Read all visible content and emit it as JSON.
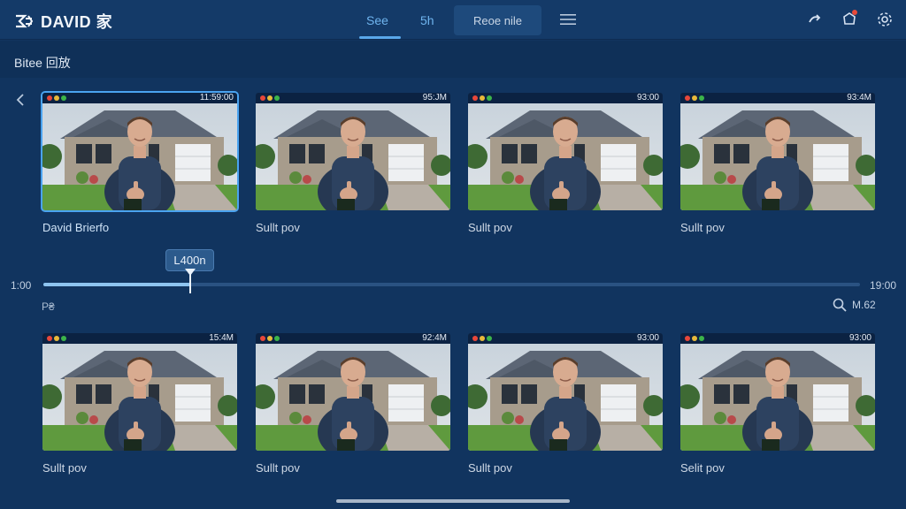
{
  "header": {
    "app_title": "DAVID 家",
    "tabs": [
      {
        "label": "See",
        "active": true
      },
      {
        "label": "5h",
        "active": false
      }
    ],
    "boxed_tab": "Reoe nile",
    "icons": [
      "logo-icon",
      "menu-icon",
      "share-icon",
      "notification-icon",
      "settings-icon"
    ]
  },
  "subheader": {
    "title": "Bitee 回放"
  },
  "row1": [
    {
      "time": "11:59:00",
      "caption": "David Brierfo",
      "selected": true
    },
    {
      "time": "95:JM",
      "caption": "Sullt pov",
      "selected": false
    },
    {
      "time": "93:00",
      "caption": "Sullt pov",
      "selected": false
    },
    {
      "time": "93:4M",
      "caption": "Sullt pov",
      "selected": false
    }
  ],
  "row2": [
    {
      "time": "15:4M",
      "caption": "Sullt pov"
    },
    {
      "time": "92:4M",
      "caption": "Sullt pov"
    },
    {
      "time": "93:00",
      "caption": "Sullt pov"
    },
    {
      "time": "93:00",
      "caption": "Selit pov"
    }
  ],
  "timeline": {
    "start": "1:00",
    "end": "19:00",
    "tooltip": "L400n",
    "progress": 0.18,
    "left_label": "P₴",
    "zoom_label": "M.62"
  },
  "colors": {
    "background": "#11345f",
    "accent": "#5aa8ea",
    "dot_red": "#e8473a",
    "dot_yellow": "#e8b93a",
    "dot_green": "#3cb54a"
  }
}
